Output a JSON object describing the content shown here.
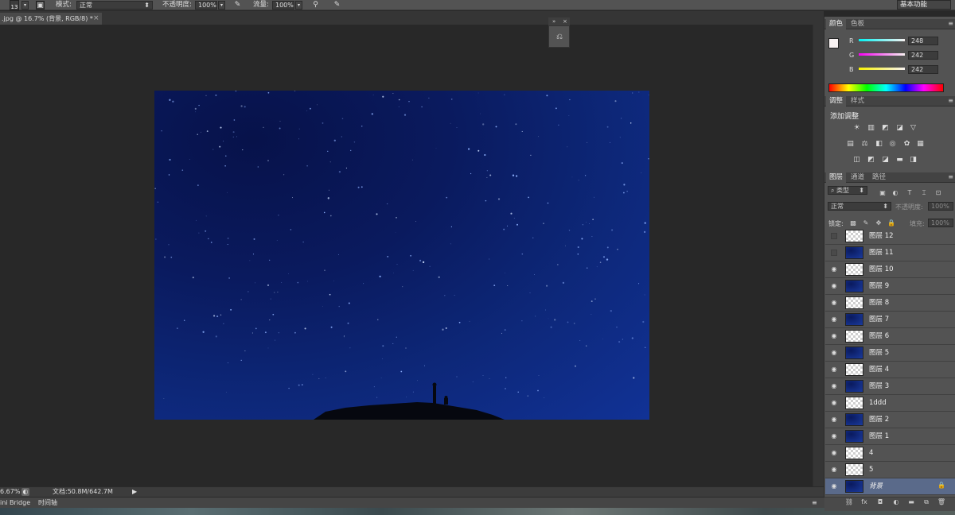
{
  "options_bar": {
    "brush_size": "13",
    "mode_label": "模式:",
    "mode_value": "正常",
    "opacity_label": "不透明度:",
    "opacity_value": "100%",
    "flow_label": "流量:",
    "flow_value": "100%",
    "workspace_value": "基本功能"
  },
  "document_tab": {
    "title": ".jpg @ 16.7% (背景, RGB/8) *",
    "close_glyph": "×"
  },
  "status_bar": {
    "zoom": "6.67%",
    "doc_info": "文档:50.8M/642.7M"
  },
  "bottom_bar": {
    "mini_bridge": "ini Bridge",
    "timeline": "时间轴"
  },
  "color_panel": {
    "tabs": [
      "颜色",
      "色板"
    ],
    "r_label": "R",
    "g_label": "G",
    "b_label": "B",
    "r_value": "248",
    "g_value": "242",
    "b_value": "242"
  },
  "adjustments_panel": {
    "tabs": [
      "调整",
      "样式"
    ],
    "heading": "添加调整"
  },
  "layers_panel": {
    "tabs": [
      "图层",
      "通道",
      "路径"
    ],
    "filter_kind": "类型",
    "blend_mode": "正常",
    "opacity_label": "不透明度:",
    "opacity_value": "100%",
    "lock_label": "锁定:",
    "fill_label": "填充:",
    "fill_value": "100%",
    "layers": [
      {
        "name": "图层 12",
        "visible": false,
        "thumb": "transparent"
      },
      {
        "name": "图层 11",
        "visible": false,
        "thumb": "night"
      },
      {
        "name": "图层 10",
        "visible": true,
        "thumb": "transparent"
      },
      {
        "name": "图层 9",
        "visible": true,
        "thumb": "night"
      },
      {
        "name": "图层 8",
        "visible": true,
        "thumb": "transparent"
      },
      {
        "name": "图层 7",
        "visible": true,
        "thumb": "night"
      },
      {
        "name": "图层 6",
        "visible": true,
        "thumb": "transparent"
      },
      {
        "name": "图层 5",
        "visible": true,
        "thumb": "night"
      },
      {
        "name": "图层 4",
        "visible": true,
        "thumb": "transparent"
      },
      {
        "name": "图层 3",
        "visible": true,
        "thumb": "night"
      },
      {
        "name": "1ddd",
        "visible": true,
        "thumb": "transparent"
      },
      {
        "name": "图层 2",
        "visible": true,
        "thumb": "night"
      },
      {
        "name": "图层 1",
        "visible": true,
        "thumb": "night"
      },
      {
        "name": "4",
        "visible": true,
        "thumb": "transparent"
      },
      {
        "name": "5",
        "visible": true,
        "thumb": "transparent"
      },
      {
        "name": "背景",
        "visible": true,
        "thumb": "night",
        "selected": true,
        "locked": true
      }
    ]
  },
  "colors": {
    "panel_bg": "#535353",
    "workspace_bg": "#282828",
    "selected_layer": "#5a6a8a",
    "sky_dark": "#07124a",
    "sky_light": "#113296"
  }
}
